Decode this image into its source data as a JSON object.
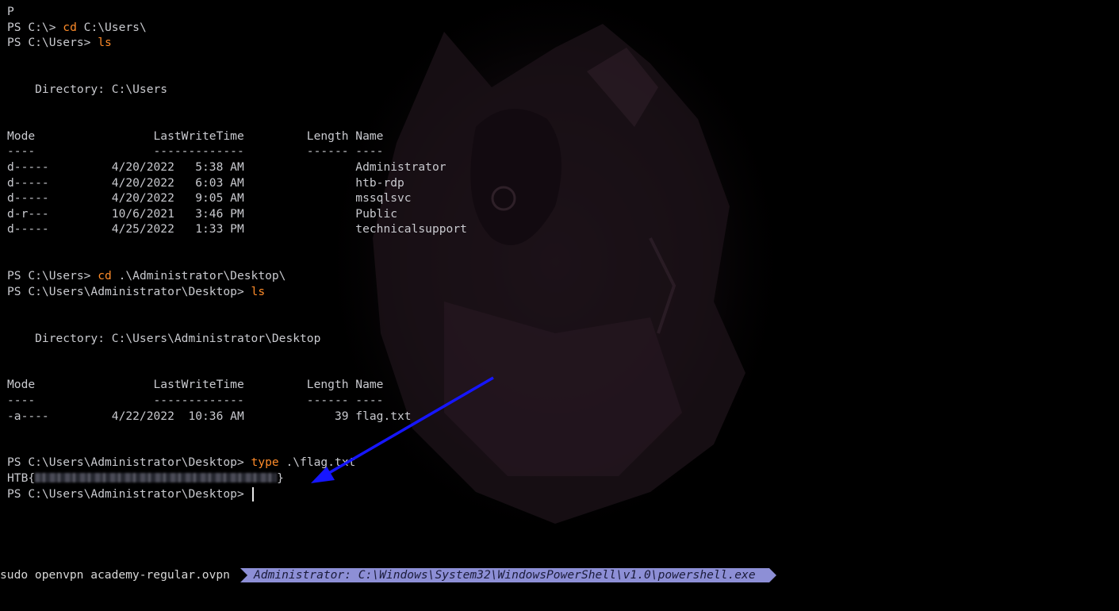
{
  "terminal": {
    "lines": [
      {
        "text": "P"
      },
      {
        "prompt": "PS C:\\> ",
        "command": "cd",
        "args": " C:\\Users\\"
      },
      {
        "prompt": "PS C:\\Users> ",
        "command": "ls",
        "args": ""
      },
      {
        "text": ""
      },
      {
        "text": ""
      },
      {
        "text": "    Directory: C:\\Users"
      },
      {
        "text": ""
      },
      {
        "text": ""
      },
      {
        "text": "Mode                 LastWriteTime         Length Name"
      },
      {
        "text": "----                 -------------         ------ ----"
      },
      {
        "text": "d-----         4/20/2022   5:38 AM                Administrator"
      },
      {
        "text": "d-----         4/20/2022   6:03 AM                htb-rdp"
      },
      {
        "text": "d-----         4/20/2022   9:05 AM                mssqlsvc"
      },
      {
        "text": "d-r---         10/6/2021   3:46 PM                Public"
      },
      {
        "text": "d-----         4/25/2022   1:33 PM                technicalsupport"
      },
      {
        "text": ""
      },
      {
        "text": ""
      },
      {
        "prompt": "PS C:\\Users> ",
        "command": "cd",
        "args": " .\\Administrator\\Desktop\\"
      },
      {
        "prompt": "PS C:\\Users\\Administrator\\Desktop> ",
        "command": "ls",
        "args": ""
      },
      {
        "text": ""
      },
      {
        "text": ""
      },
      {
        "text": "    Directory: C:\\Users\\Administrator\\Desktop"
      },
      {
        "text": ""
      },
      {
        "text": ""
      },
      {
        "text": "Mode                 LastWriteTime         Length Name"
      },
      {
        "text": "----                 -------------         ------ ----"
      },
      {
        "text": "-a----         4/22/2022  10:36 AM             39 flag.txt"
      },
      {
        "text": ""
      },
      {
        "text": ""
      },
      {
        "prompt": "PS C:\\Users\\Administrator\\Desktop> ",
        "command": "type",
        "args": " .\\flag.txt"
      },
      {
        "flag_prefix": "HTB{",
        "flag_suffix": "}"
      },
      {
        "prompt": "PS C:\\Users\\Administrator\\Desktop> ",
        "cursor": true
      }
    ]
  },
  "statusbar": {
    "left_text": "sudo openvpn academy-regular.ovpn",
    "active_tab_label": "Administrator: C:\\Windows\\System32\\WindowsPowerShell\\v1.0\\powershell.exe"
  },
  "colors": {
    "background": "#000000",
    "text": "#c9cacf",
    "command": "#ff8c2a",
    "arrow": "#1a1aff",
    "tab_background": "#8d8fd6"
  }
}
